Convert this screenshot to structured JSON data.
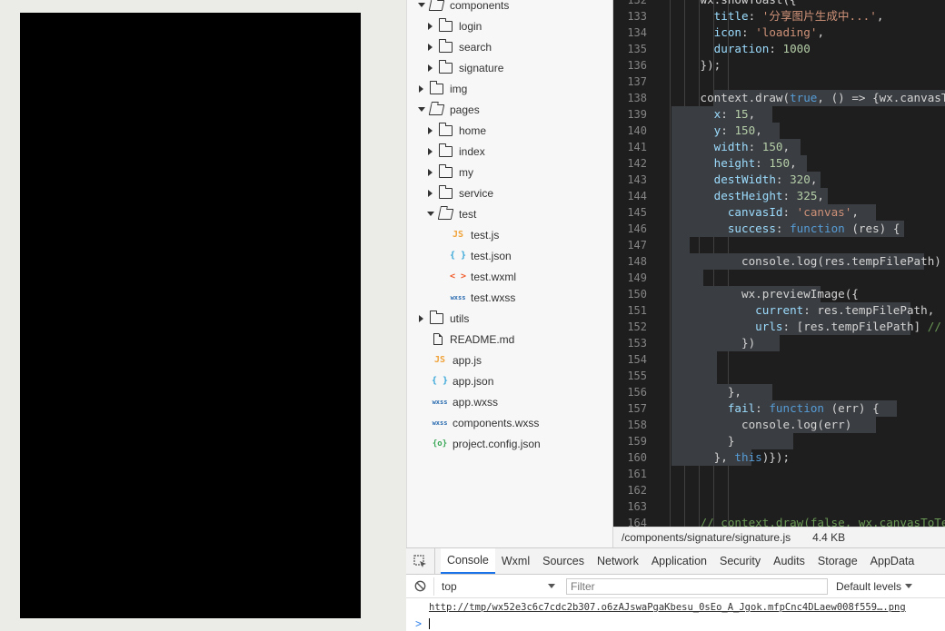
{
  "file_tree": [
    {
      "label": "components",
      "type": "folder",
      "state": "open",
      "depth": 0
    },
    {
      "label": "login",
      "type": "folder",
      "state": "closed",
      "depth": 1
    },
    {
      "label": "search",
      "type": "folder",
      "state": "closed",
      "depth": 1
    },
    {
      "label": "signature",
      "type": "folder",
      "state": "closed",
      "depth": 1
    },
    {
      "label": "img",
      "type": "folder",
      "state": "closed",
      "depth": 0
    },
    {
      "label": "pages",
      "type": "folder",
      "state": "open",
      "depth": 0
    },
    {
      "label": "home",
      "type": "folder",
      "state": "closed",
      "depth": 1
    },
    {
      "label": "index",
      "type": "folder",
      "state": "closed",
      "depth": 1
    },
    {
      "label": "my",
      "type": "folder",
      "state": "closed",
      "depth": 1
    },
    {
      "label": "service",
      "type": "folder",
      "state": "closed",
      "depth": 1
    },
    {
      "label": "test",
      "type": "folder",
      "state": "open",
      "depth": 1
    },
    {
      "label": "test.js",
      "type": "js",
      "depth": 2
    },
    {
      "label": "test.json",
      "type": "json",
      "depth": 2
    },
    {
      "label": "test.wxml",
      "type": "wxml",
      "depth": 2
    },
    {
      "label": "test.wxss",
      "type": "wxss",
      "depth": 2
    },
    {
      "label": "utils",
      "type": "folder",
      "state": "closed",
      "depth": 0
    },
    {
      "label": "README.md",
      "type": "doc",
      "depth": 0
    },
    {
      "label": "app.js",
      "type": "js",
      "depth": 0
    },
    {
      "label": "app.json",
      "type": "json",
      "depth": 0
    },
    {
      "label": "app.wxss",
      "type": "wxss",
      "depth": 0
    },
    {
      "label": "components.wxss",
      "type": "wxss",
      "depth": 0
    },
    {
      "label": "project.config.json",
      "type": "project",
      "depth": 0
    }
  ],
  "file_icons": {
    "js": "JS",
    "json": "{ }",
    "wxml": "< >",
    "wxss": "wxss",
    "project": "{o}"
  },
  "code_lines": [
    {
      "n": "132",
      "code": "      wx.showToast({"
    },
    {
      "n": "133",
      "code": "        title: '分享图片生成中...',"
    },
    {
      "n": "134",
      "code": "        icon: 'loading',"
    },
    {
      "n": "135",
      "code": "        duration: 1000"
    },
    {
      "n": "136",
      "code": "      });"
    },
    {
      "n": "137",
      "code": ""
    },
    {
      "n": "138",
      "code": "      context.draw(true, () => {wx.canvasToTempFilePath({"
    },
    {
      "n": "139",
      "code": "        x: 15,"
    },
    {
      "n": "140",
      "code": "        y: 150,"
    },
    {
      "n": "141",
      "code": "        width: 150,"
    },
    {
      "n": "142",
      "code": "        height: 150,"
    },
    {
      "n": "143",
      "code": "        destWidth: 320,"
    },
    {
      "n": "144",
      "code": "        destHeight: 325,"
    },
    {
      "n": "145",
      "code": "          canvasId: 'canvas',"
    },
    {
      "n": "146",
      "code": "          success: function (res) {"
    },
    {
      "n": "147",
      "code": ""
    },
    {
      "n": "148",
      "code": "            console.log(res.tempFilePath)"
    },
    {
      "n": "149",
      "code": ""
    },
    {
      "n": "150",
      "code": "            wx.previewImage({"
    },
    {
      "n": "151",
      "code": "              current: res.tempFilePath,"
    },
    {
      "n": "152",
      "code": "              urls: [res.tempFilePath] //"
    },
    {
      "n": "153",
      "code": "            })"
    },
    {
      "n": "154",
      "code": ""
    },
    {
      "n": "155",
      "code": ""
    },
    {
      "n": "156",
      "code": "          },"
    },
    {
      "n": "157",
      "code": "          fail: function (err) {"
    },
    {
      "n": "158",
      "code": "            console.log(err)"
    },
    {
      "n": "159",
      "code": "          }"
    },
    {
      "n": "160",
      "code": "        }, this)});"
    },
    {
      "n": "161",
      "code": ""
    },
    {
      "n": "162",
      "code": ""
    },
    {
      "n": "163",
      "code": ""
    },
    {
      "n": "164",
      "code": "      // context.draw(false, wx.canvasToTempFilePath({"
    }
  ],
  "status_bar": {
    "path": "/components/signature/signature.js",
    "size": "4.4 KB"
  },
  "devtools": {
    "tabs": [
      "Console",
      "Wxml",
      "Sources",
      "Network",
      "Application",
      "Security",
      "Audits",
      "Storage",
      "AppData"
    ],
    "active_tab": "Console",
    "context": "top",
    "filter_placeholder": "Filter",
    "levels": "Default levels",
    "log_link": "http://tmp/wx52e3c6c7cdc2b307.o6zAJswaPgaKbesu_0sEo_A_Jgok.mfpCnc4DLaew008f559….png",
    "prompt": ">"
  },
  "colors": {
    "editor_bg": "#1e1e1e",
    "selection": "#3a3d41",
    "active_tab": "#1a73e8"
  }
}
